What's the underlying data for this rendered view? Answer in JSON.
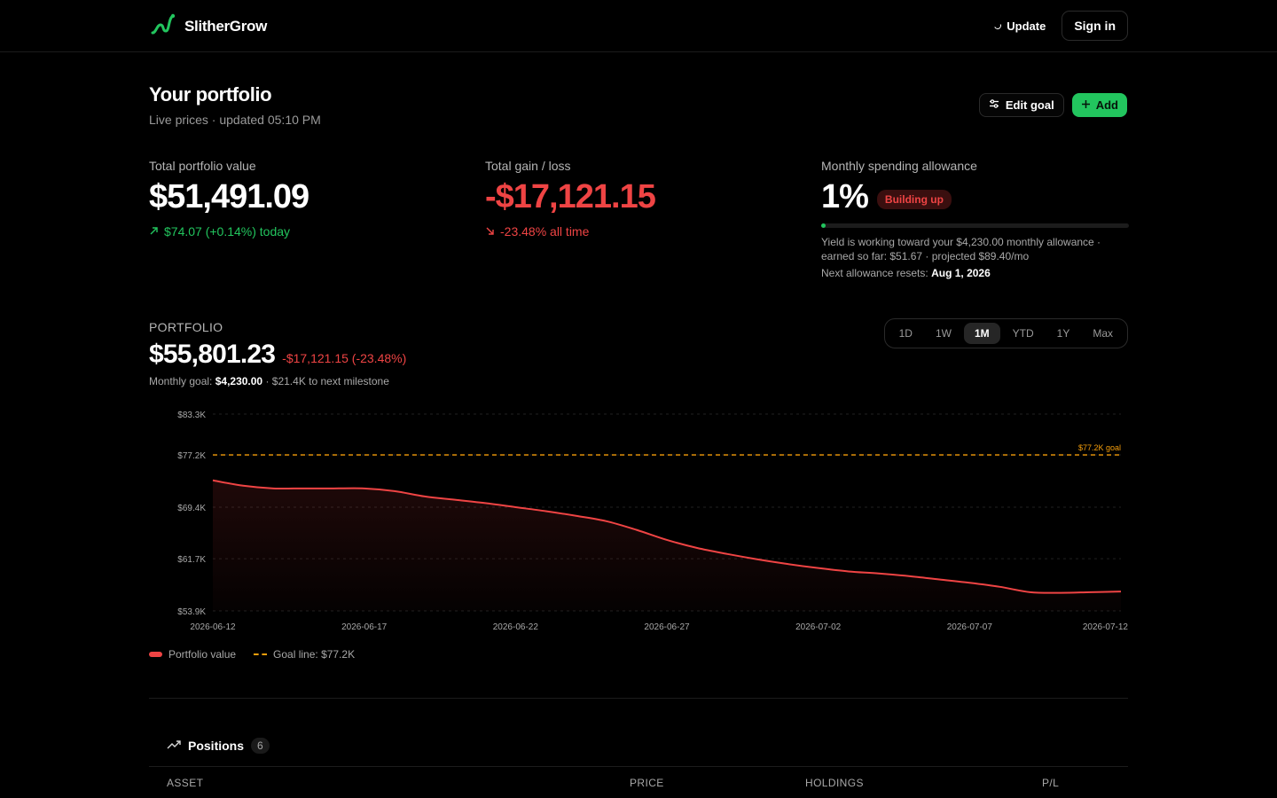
{
  "brand": {
    "name": "SlitherGrow"
  },
  "topbar": {
    "update_label": "Update",
    "signin_label": "Sign in"
  },
  "header": {
    "title": "Your portfolio",
    "subtitle": "Live prices · updated 05:10 PM",
    "edit_goal_label": "Edit goal",
    "add_label": "Add"
  },
  "stats": {
    "total_value": {
      "label": "Total portfolio value",
      "value": "$51,491.09",
      "change": "$74.07 (+0.14%) today"
    },
    "total_gain": {
      "label": "Total gain / loss",
      "value": "-$17,121.15",
      "change": "-23.48% all time"
    },
    "allowance": {
      "label": "Monthly spending allowance",
      "value": "1%",
      "badge": "Building up",
      "progress": 0.01,
      "detail": "Yield is working toward your $4,230.00 monthly allowance · earned so far: $51.67 · projected $89.40/mo",
      "reset_label": "Next allowance resets:",
      "reset_date": "Aug 1, 2026"
    }
  },
  "portfolio": {
    "label": "PORTFOLIO",
    "value": "$55,801.23",
    "change": "-$17,121.15 (-23.48%)",
    "goal_prefix": "Monthly goal:",
    "goal_amount": "$4,230.00",
    "goal_suffix": "· $21.4K to next milestone"
  },
  "ranges": [
    "1D",
    "1W",
    "1M",
    "YTD",
    "1Y",
    "Max"
  ],
  "active_range": "1M",
  "chart_data": {
    "type": "area",
    "x": [
      "2026-06-12",
      "2026-06-13",
      "2026-06-14",
      "2026-06-15",
      "2026-06-16",
      "2026-06-17",
      "2026-06-18",
      "2026-06-19",
      "2026-06-20",
      "2026-06-21",
      "2026-06-22",
      "2026-06-23",
      "2026-06-24",
      "2026-06-25",
      "2026-06-26",
      "2026-06-27",
      "2026-06-28",
      "2026-06-29",
      "2026-06-30",
      "2026-07-01",
      "2026-07-02",
      "2026-07-03",
      "2026-07-04",
      "2026-07-05",
      "2026-07-06",
      "2026-07-07",
      "2026-07-08",
      "2026-07-09",
      "2026-07-10",
      "2026-07-11",
      "2026-07-12"
    ],
    "y": [
      73.4,
      72.6,
      72.2,
      72.2,
      72.2,
      72.2,
      71.8,
      71.0,
      70.5,
      70.0,
      69.4,
      68.8,
      68.1,
      67.3,
      66.0,
      64.5,
      63.3,
      62.4,
      61.6,
      60.9,
      60.3,
      59.8,
      59.5,
      59.1,
      58.6,
      58.1,
      57.5,
      56.7,
      56.6,
      56.7,
      56.8
    ],
    "series": [
      {
        "name": "Portfolio value",
        "color": "#ef4444"
      }
    ],
    "goal": {
      "value": 77.2,
      "label": "$77.2K goal",
      "legend": "Goal line: $77.2K",
      "color": "#f59e0b"
    },
    "ylim": [
      53.9,
      83.3
    ],
    "y_ticks": [
      53.9,
      61.7,
      69.4,
      77.2,
      83.3
    ],
    "y_tick_labels": [
      "$53.9K",
      "$61.7K",
      "$69.4K",
      "$77.2K",
      "$83.3K"
    ],
    "x_tick_labels": [
      "2026-06-12",
      "2026-06-17",
      "2026-06-22",
      "2026-06-27",
      "2026-07-02",
      "2026-07-07",
      "2026-07-12"
    ],
    "x_tick_index": [
      0,
      5,
      10,
      15,
      20,
      25,
      30
    ],
    "legend": [
      "Portfolio value",
      "Goal line: $77.2K"
    ],
    "grid": true
  },
  "positions": {
    "title": "Positions",
    "count": "6",
    "columns": [
      "ASSET",
      "PRICE",
      "HOLDINGS",
      "P/L"
    ]
  },
  "colors": {
    "accent": "#22c55e",
    "negative": "#ef4444",
    "goal": "#f59e0b",
    "background": "#000000"
  }
}
